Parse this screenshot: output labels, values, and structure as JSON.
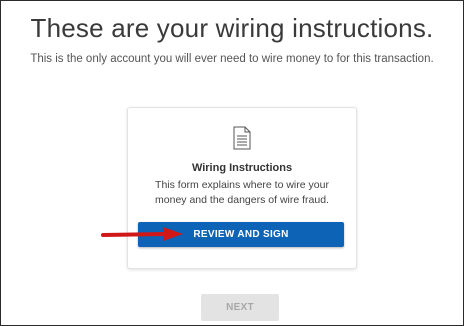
{
  "header": {
    "title": "These are your wiring instructions.",
    "subtitle": "This is the only account you will ever need to wire money to for this transaction."
  },
  "card": {
    "icon": "document-icon",
    "title": "Wiring Instructions",
    "description": "This form explains where to wire your money and the dangers of wire fraud.",
    "review_label": "REVIEW AND SIGN"
  },
  "annotation": {
    "arrow_icon": "red-arrow-icon"
  },
  "footer": {
    "next_label": "NEXT"
  },
  "colors": {
    "primary": "#0d64b6",
    "arrow": "#d01818",
    "disabled_bg": "#e3e3e3",
    "disabled_text": "#a8a8a8"
  }
}
